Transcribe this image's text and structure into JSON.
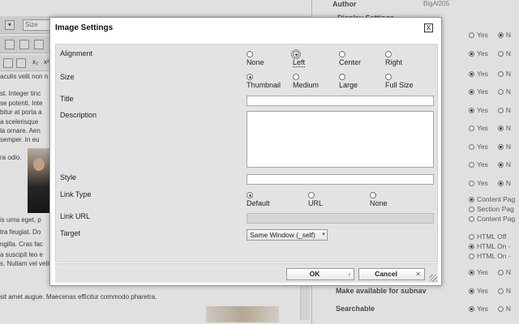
{
  "editor": {
    "font_size_select": "Size",
    "toolbar_glyphs": [
      "x₂",
      "x²"
    ],
    "text_lines": [
      "aculis velit non n",
      "",
      "st. Integer tinc",
      "se potenti. Inte",
      "bitur at porta a",
      "a scelerisque",
      "la ornare. Aen",
      "semper. In eu",
      "",
      "ra odio.",
      "",
      "is urna eget, p",
      "tra feugiat. Do",
      "ngilla. Cras fac",
      "a suscipit leo e",
      "s. Nullam vel velit a purus ullamcorper scelerisque. Quisque felis metus, fermentum",
      "sit amet augue. Maecenas efficitur commodo pharetra."
    ]
  },
  "settings_panel": {
    "author_label": "Author",
    "author_value": "BigAl205",
    "section_heading": "Display Settings",
    "rows": [
      {
        "label": "",
        "option": "Yes",
        "option2": "N",
        "selected": 2
      },
      {
        "label": "",
        "option": "Yes",
        "option2": "N",
        "selected": 1
      },
      {
        "label": "",
        "option": "Yes",
        "option2": "N",
        "selected": 1
      },
      {
        "label": "",
        "option": "Yes",
        "option2": "N",
        "selected": 1
      },
      {
        "label": "",
        "option": "Yes",
        "option2": "N",
        "selected": 1
      },
      {
        "label": "",
        "option": "Yes",
        "option2": "N",
        "selected": 2
      },
      {
        "label": "",
        "option": "Yes",
        "option2": "N",
        "selected": 2
      },
      {
        "label": "",
        "option": "Yes",
        "option2": "N",
        "selected": 2
      },
      {
        "label": "",
        "option": "Yes",
        "option2": "N",
        "selected": 2
      }
    ],
    "content_page_options": [
      "Content Pag",
      "Section Pag",
      "Content Pag"
    ],
    "html_options": [
      "HTML Off",
      "HTML On -",
      "HTML On -"
    ],
    "bottom_rows": [
      {
        "label": "",
        "option": "Yes",
        "option2": "N",
        "selected": 1
      },
      {
        "label": "Make available for subnav",
        "option": "Yes",
        "option2": "N",
        "selected": 1
      },
      {
        "label": "Searchable",
        "option": "Yes",
        "option2": "N",
        "selected": 1
      }
    ]
  },
  "dialog": {
    "title": "Image Settings",
    "close_glyph": "X",
    "alignment": {
      "label": "Alignment",
      "options": [
        "None",
        "Left",
        "Center",
        "Right"
      ],
      "selected": "Left"
    },
    "size": {
      "label": "Size",
      "options": [
        "Thumbnail",
        "Medium",
        "Large",
        "Full Size"
      ],
      "selected": "Thumbnail"
    },
    "title_field": {
      "label": "Title",
      "value": ""
    },
    "description_field": {
      "label": "Description",
      "value": ""
    },
    "style_field": {
      "label": "Style",
      "value": ""
    },
    "link_type": {
      "label": "Link Type",
      "options": [
        "Default",
        "URL",
        "None"
      ],
      "selected": "Default"
    },
    "link_url": {
      "label": "Link URL",
      "value": ""
    },
    "target": {
      "label": "Target",
      "value": "Same Window (_self)"
    },
    "ok_label": "OK",
    "ok_icon": "›",
    "cancel_label": "Cancel",
    "cancel_icon": "✕"
  }
}
